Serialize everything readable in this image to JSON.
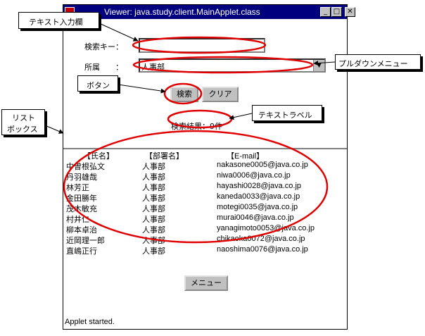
{
  "window": {
    "title": "Viewer: java.study.client.MainApplet.class",
    "controls": {
      "minimize": "_",
      "maximize": "□",
      "close": "✕"
    },
    "status": "Applet started."
  },
  "form": {
    "search_key_label": "検索キー：",
    "search_key_value": "",
    "department_label": "所属　　：",
    "department_value": "人事部",
    "search_button": "検索",
    "clear_button": "クリア",
    "result_label": "検索結果：9件",
    "menu_button": "メニュー"
  },
  "list": {
    "headers": [
      "【氏名】",
      "【部署名】",
      "【E-mail】"
    ],
    "rows": [
      [
        "中曽根弘文",
        "人事部",
        "nakasone0005@java.co.jp"
      ],
      [
        "丹羽雄哉",
        "人事部",
        "niwa0006@java.co.jp"
      ],
      [
        "林芳正",
        "人事部",
        "hayashi0028@java.co.jp"
      ],
      [
        "金田勝年",
        "人事部",
        "kaneda0033@java.co.jp"
      ],
      [
        "茂木敏充",
        "人事部",
        "motegi0035@java.co.jp"
      ],
      [
        "村井仁",
        "人事部",
        "murai0046@java.co.jp"
      ],
      [
        "柳本卓治",
        "人事部",
        "yanagimoto0053@java.co.jp"
      ],
      [
        "近岡理一郎",
        "人事部",
        "chikaoka0072@java.co.jp"
      ],
      [
        "直嶋正行",
        "人事部",
        "naoshima0076@java.co.jp"
      ]
    ]
  },
  "annotations": {
    "text_input": "テキスト入力欄",
    "pulldown_menu": "プルダウンメニュー",
    "button": "ボタン",
    "text_label": "テキストラベル",
    "listbox_line1": "リスト",
    "listbox_line2": "ボックス"
  },
  "colors": {
    "titlebar": "#00007f",
    "window_face": "#c0c0c0",
    "annotation_ellipse": "#e00000"
  }
}
